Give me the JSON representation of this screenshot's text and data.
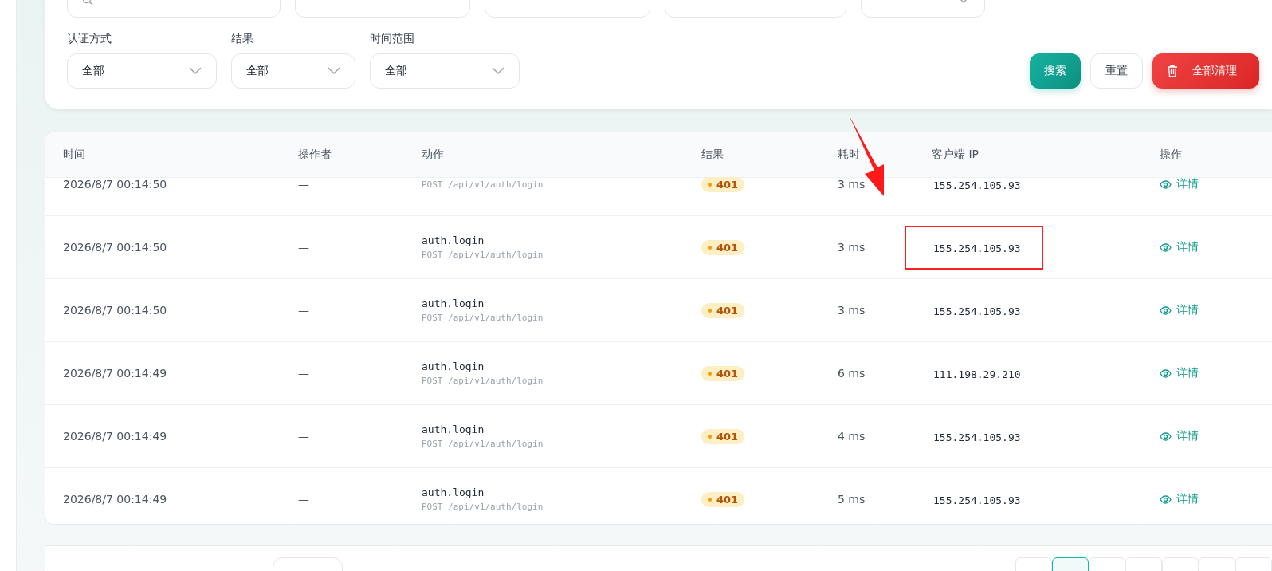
{
  "filters": {
    "top_fields": [
      {
        "kind": "search"
      },
      {
        "kind": "input"
      },
      {
        "kind": "input"
      },
      {
        "kind": "input"
      },
      {
        "kind": "select"
      }
    ],
    "selects": [
      {
        "label": "认证方式",
        "value": "全部"
      },
      {
        "label": "结果",
        "value": "全部"
      },
      {
        "label": "时间范围",
        "value": "全部"
      }
    ],
    "buttons": [
      {
        "kind": "primary",
        "label": "搜索"
      },
      {
        "kind": "plain",
        "label": "重置"
      },
      {
        "kind": "danger",
        "label": "全部清理"
      }
    ]
  },
  "table": {
    "columns": [
      "时间",
      "操作者",
      "动作",
      "结果",
      "耗时",
      "客户端 IP",
      "操作"
    ],
    "rows": [
      {
        "time": "2026/8/7 00:14:50",
        "operator": "—",
        "request": "POST /api/v1/auth/login",
        "result": "401",
        "duration": "3 ms",
        "ip": "155.254.105.93",
        "action_link": "详情",
        "highlighted": false
      },
      {
        "time": "2026/8/7 00:14:50",
        "operator": "—",
        "action": "auth.login",
        "request": "POST /api/v1/auth/login",
        "result": "401",
        "duration": "3 ms",
        "ip": "155.254.105.93",
        "action_link": "详情",
        "highlighted": true
      },
      {
        "time": "2026/8/7 00:14:50",
        "operator": "—",
        "action": "auth.login",
        "request": "POST /api/v1/auth/login",
        "result": "401",
        "duration": "3 ms",
        "ip": "155.254.105.93",
        "action_link": "详情",
        "highlighted": false
      },
      {
        "time": "2026/8/7 00:14:49",
        "operator": "—",
        "action": "auth.login",
        "request": "POST /api/v1/auth/login",
        "result": "401",
        "duration": "6 ms",
        "ip": "111.198.29.210",
        "action_link": "详情",
        "highlighted": false
      },
      {
        "time": "2026/8/7 00:14:49",
        "operator": "—",
        "action": "auth.login",
        "request": "POST /api/v1/auth/login",
        "result": "401",
        "duration": "4 ms",
        "ip": "155.254.105.93",
        "action_link": "详情",
        "highlighted": false
      },
      {
        "time": "2026/8/7 00:14:49",
        "operator": "—",
        "action": "auth.login",
        "request": "POST /api/v1/auth/login",
        "result": "401",
        "duration": "5 ms",
        "ip": "155.254.105.93",
        "action_link": "详情",
        "highlighted": false
      }
    ]
  }
}
